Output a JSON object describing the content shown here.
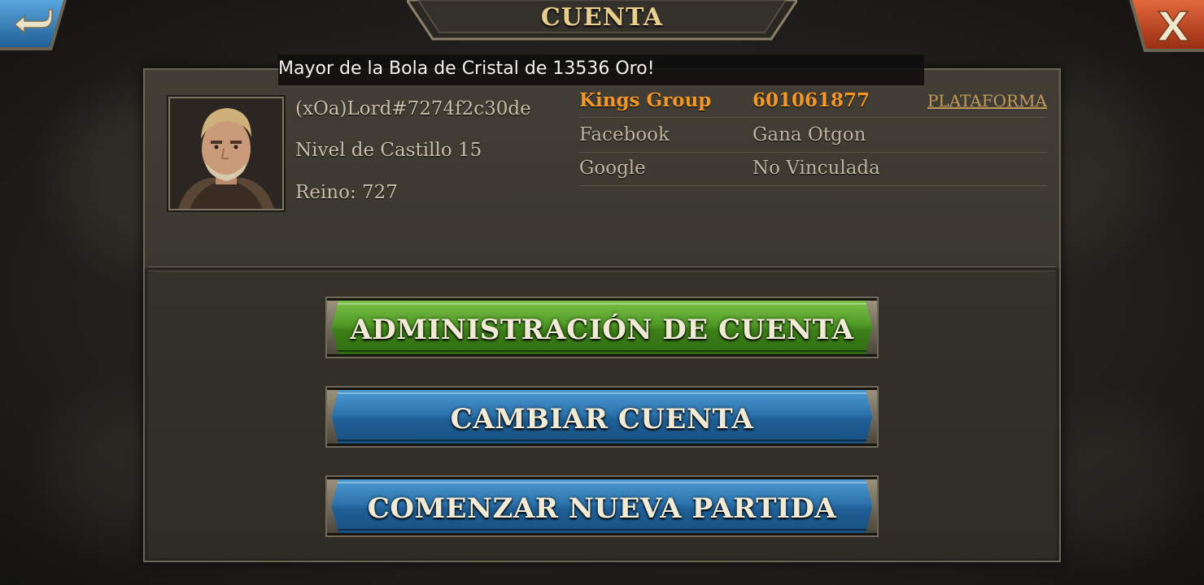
{
  "window": {
    "title": "CUENTA"
  },
  "notification": {
    "text": "Mayor de la Bola de Cristal de 13536 Oro!"
  },
  "profile": {
    "name": "(xOa)Lord#7274f2c30de",
    "castle_level": "Nivel de Castillo 15",
    "kingdom": "Reino: 727"
  },
  "accounts": {
    "platform_link": "PLATAFORMA",
    "rows": [
      {
        "platform": "Kings Group",
        "value": "601061877"
      },
      {
        "platform": "Facebook",
        "value": "Gana Otgon"
      },
      {
        "platform": "Google",
        "value": "No Vinculada"
      }
    ]
  },
  "actions": {
    "manage": "ADMINISTRACIÓN DE CUENTA",
    "switch": "CAMBIAR CUENTA",
    "new_game": "COMENZAR NUEVA PARTIDA"
  },
  "icons": {
    "back": "back-arrow-icon",
    "close": "close-x-icon"
  },
  "colors": {
    "highlight_orange": "#f19826",
    "title_gold": "#e8cf8e",
    "green_button": "#4f9a26",
    "blue_button": "#2d73ad",
    "close_red": "#c2401f"
  }
}
